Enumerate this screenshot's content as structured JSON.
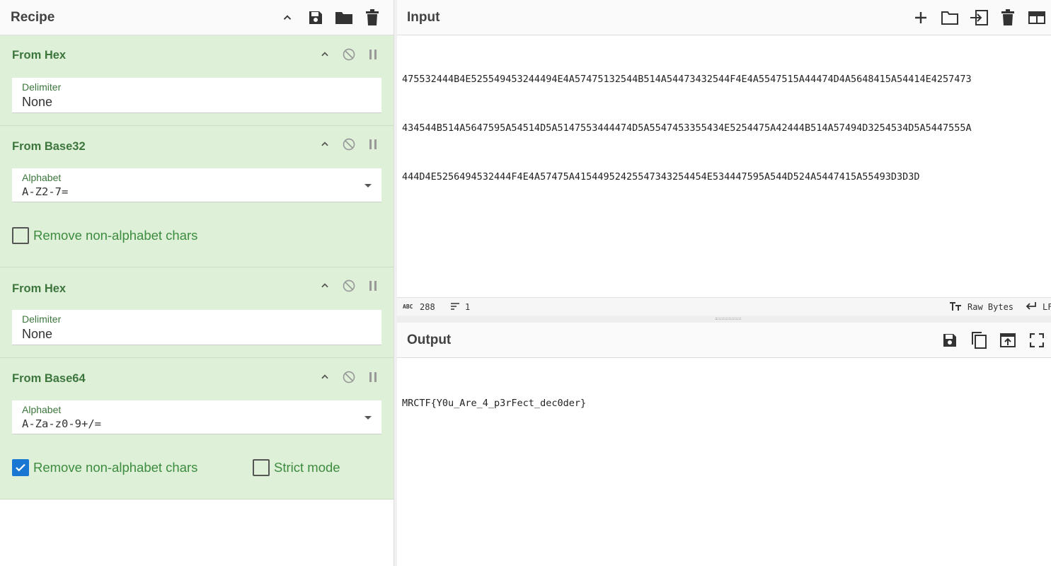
{
  "recipe": {
    "title": "Recipe",
    "operations": [
      {
        "name": "From Hex",
        "fields": [
          {
            "label": "Delimiter",
            "value": "None"
          }
        ]
      },
      {
        "name": "From Base32",
        "fields": [
          {
            "label": "Alphabet",
            "value": "A-Z2-7="
          }
        ],
        "checkboxes": [
          {
            "label": "Remove non-alphabet chars",
            "checked": false
          }
        ]
      },
      {
        "name": "From Hex",
        "fields": [
          {
            "label": "Delimiter",
            "value": "None"
          }
        ]
      },
      {
        "name": "From Base64",
        "fields": [
          {
            "label": "Alphabet",
            "value": "A-Za-z0-9+/="
          }
        ],
        "checkboxes": [
          {
            "label": "Remove non-alphabet chars",
            "checked": true
          },
          {
            "label": "Strict mode",
            "checked": false
          }
        ]
      }
    ]
  },
  "input": {
    "title": "Input",
    "lines": [
      "475532444B4E525549453244494E4A57475132544B514A54473432544F4E4A5547515A44474D4A5648415A54414E4257473",
      "434544B514A5647595A54514D5A5147553444474D5A5547453355434E5254475A42444B514A57494D3254534D5A5447555A",
      "444D4E5256494532444F4E4A57475A41544952425547343254454E534447595A544D524A5447415A55493D3D3D"
    ],
    "status": {
      "length": "288",
      "lines": "1",
      "encoding": "Raw Bytes",
      "eol": "LF"
    }
  },
  "output": {
    "title": "Output",
    "text": "MRCTF{Y0u_Are_4_p3rFect_dec0der}"
  },
  "colors": {
    "op_bg": "#dff0d8",
    "op_text": "#3c763d",
    "checkbox_on": "#1976d2"
  },
  "icons": {
    "recipe_header": [
      "chevron-up-icon",
      "save-icon",
      "folder-icon",
      "trash-icon"
    ],
    "op_controls": [
      "chevron-up-icon",
      "disable-icon",
      "pause-icon"
    ],
    "input_header": [
      "plus-icon",
      "folder-icon",
      "input-icon",
      "trash-icon",
      "layout-icon"
    ],
    "output_header": [
      "save-icon",
      "copy-icon",
      "open-in-input-icon",
      "maximize-icon"
    ]
  }
}
